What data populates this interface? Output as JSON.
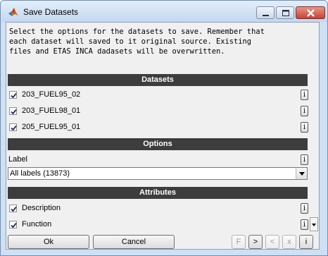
{
  "window": {
    "title": "Save Datasets"
  },
  "intro": "Select the options for the datasets to save. Remember that\neach dataset will saved to it original source. Existing\nfiles and ETAS INCA dadasets will be overwritten.",
  "sections": {
    "datasets": "Datasets",
    "options": "Options",
    "attributes": "Attributes"
  },
  "datasets": [
    {
      "label": "203_FUEL95_02",
      "checked": true
    },
    {
      "label": "203_FUEL98_01",
      "checked": true
    },
    {
      "label": "205_FUEL95_01",
      "checked": true
    }
  ],
  "options": {
    "label_caption": "Label",
    "label_value": "All labels (13873)"
  },
  "attributes": [
    {
      "label": "Description",
      "checked": true
    },
    {
      "label": "Function",
      "checked": true
    }
  ],
  "info_glyph": "i",
  "footer": {
    "ok": "Ok",
    "cancel": "Cancel",
    "nav": [
      "F",
      ">",
      "<",
      "x",
      "i"
    ]
  }
}
